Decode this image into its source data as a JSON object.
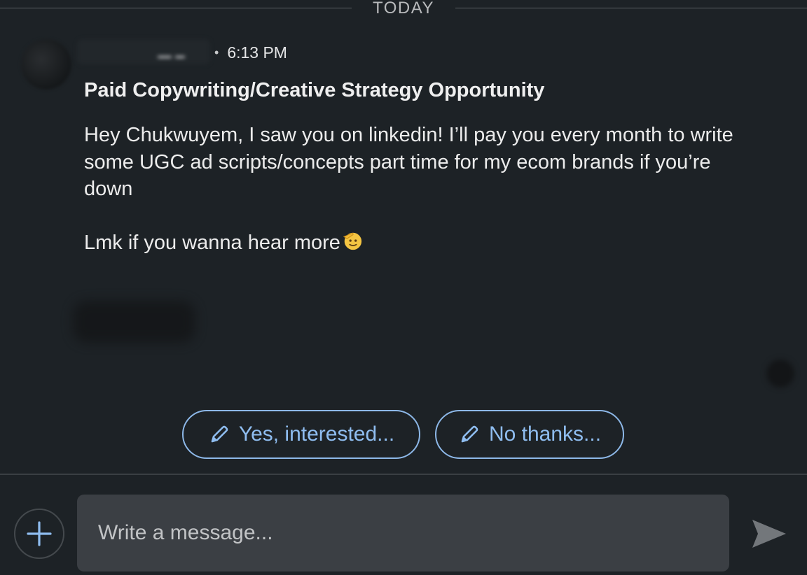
{
  "divider": {
    "label": "TODAY"
  },
  "message": {
    "time": "6:13 PM",
    "subject": "Paid Copywriting/Creative Strategy Opportunity",
    "paragraph_1": "Hey Chukwuyem, I saw you on linkedin! I’ll pay you every month to write some UGC ad scripts/concepts part time for my ecom brands if you’re down",
    "paragraph_2": "Lmk if you wanna hear more"
  },
  "quick_replies": {
    "yes_label": "Yes, interested...",
    "no_label": "No thanks..."
  },
  "composer": {
    "placeholder": "Write a message..."
  },
  "icons": {
    "add": "plus-icon",
    "send": "send-icon",
    "reply": "pencil-icon",
    "emoji": "saluting-face-emoji"
  },
  "colors": {
    "background": "#1d2226",
    "accent": "#8fbdf0",
    "input_background": "#3b3f44"
  }
}
